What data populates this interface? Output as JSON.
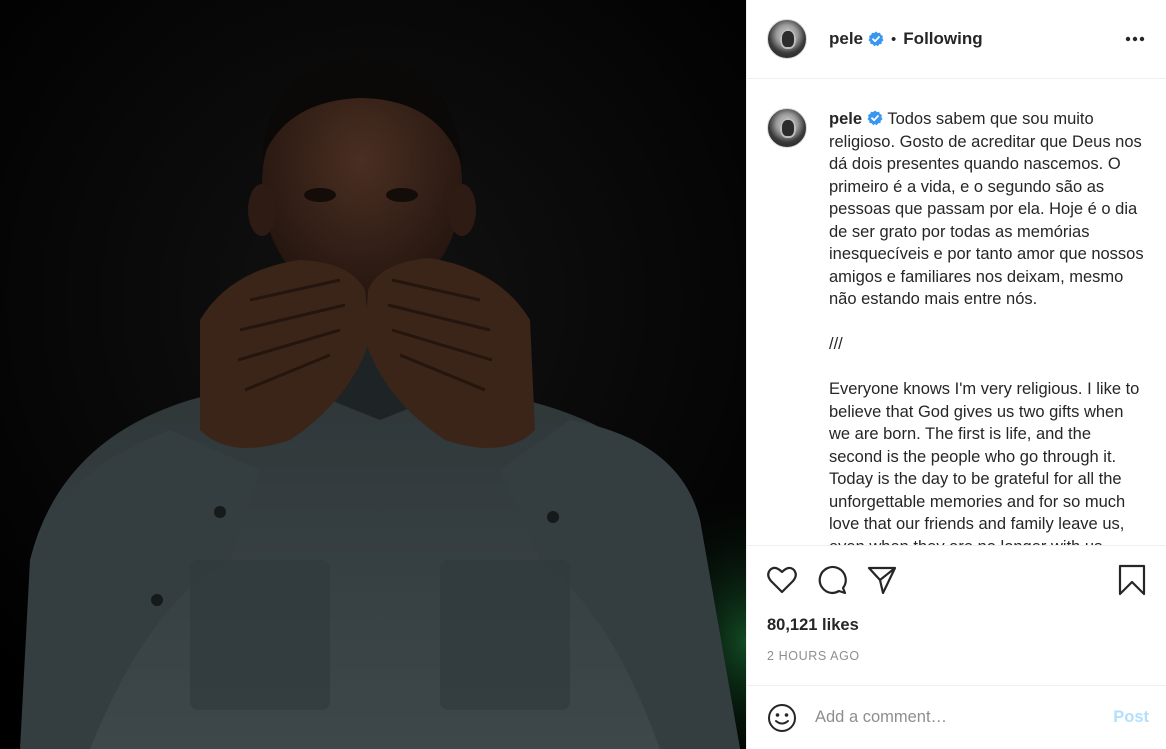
{
  "post": {
    "photo_alt": "",
    "author": {
      "username": "pele",
      "verified": true,
      "follow_status": "Following"
    },
    "separator": "•",
    "caption": {
      "username": "pele",
      "text": " Todos sabem que sou muito religioso. Gosto de acreditar que Deus nos dá dois presentes quando nascemos. O primeiro é a vida, e o segundo são as pessoas que passam por ela. Hoje é o dia de ser grato por todas as memórias inesquecíveis e por tanto amor que nossos amigos e familiares nos deixam, mesmo não estando mais entre nós.\n\n///\n\nEveryone knows I'm very religious. I like to believe that God gives us two gifts when we are born. The first is life, and the second is the people who go through it. Today is the day to be grateful for all the unforgettable memories and for so much love that our friends and family leave us, even when they are no longer with us."
    },
    "likes": "80,121 likes",
    "timestamp": "2 HOURS AGO",
    "comment": {
      "placeholder": "Add a comment…",
      "value": "",
      "post_label": "Post"
    }
  },
  "icons": {
    "more": "more-options-icon",
    "like": "heart-icon",
    "comment": "comment-icon",
    "share": "paper-plane-icon",
    "save": "bookmark-icon",
    "emoji": "emoji-icon",
    "verified": "verified-badge-icon"
  },
  "colors": {
    "verified_blue": "#3897f0",
    "post_disabled": "#b2dffc",
    "text": "#262626",
    "muted": "#8e8e8e",
    "divider": "#efefef",
    "shirt": "#3a4447"
  }
}
